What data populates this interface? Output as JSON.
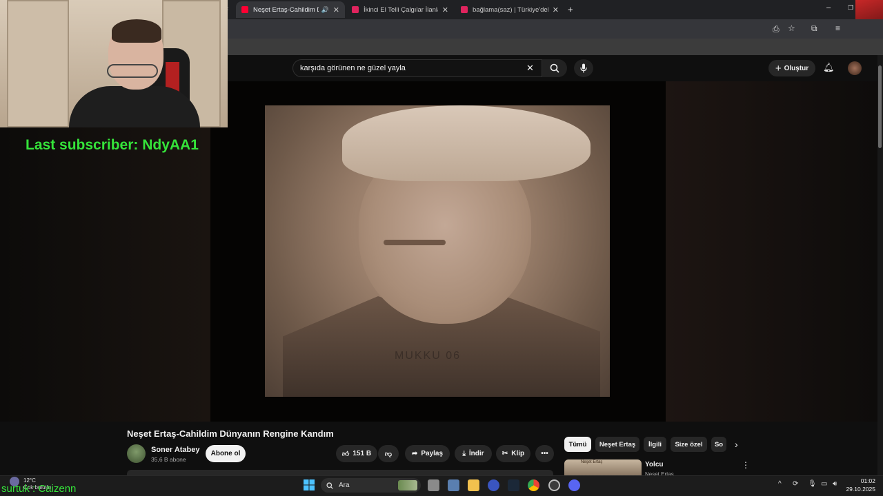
{
  "tabs": [
    {
      "title": "Neşet Ertaş-Cahildim Dünyanın",
      "favicon_color": "#ff0033",
      "active": true
    },
    {
      "title": "İkinci El Telli Çalgılar İlanları ve",
      "favicon_color": "#e0245e",
      "active": false
    },
    {
      "title": "bağlama(saz) | Türkiye'deki İkinci",
      "favicon_color": "#e0245e",
      "active": false
    }
  ],
  "new_tab_label": "+",
  "search": {
    "query": "karşıda görünen ne güzel yayla"
  },
  "header": {
    "create_label": "Oluştur"
  },
  "overlay": {
    "subscriber": "Last subscriber: NdyAA1",
    "streamer_tag": "surtuk : Caizenn"
  },
  "video": {
    "watermark": "MUKKU 06",
    "title": "Neşet Ertaş-Cahildim Dünyanın Rengine Kandım"
  },
  "channel": {
    "name": "Soner Atabey",
    "subscribers": "35,6 B abone",
    "subscribe_label": "Abone ol"
  },
  "actions": {
    "likes": "151 B",
    "share": "Paylaş",
    "download": "İndir",
    "clip": "Klip"
  },
  "chips": [
    "Tümü",
    "Neşet Ertaş",
    "İlgili",
    "Size özel",
    "So"
  ],
  "recommendation": {
    "title": "Yolcu",
    "channel": "Neşet Ertaş",
    "thumb_label": "Neşet Ertaş"
  },
  "taskbar": {
    "search_placeholder": "Ara",
    "weather_temp": "12°C",
    "weather_label": "Çok bulutlu",
    "time": "01:02",
    "date": "29.10.2025"
  },
  "colors": {
    "accent_green": "#35e33a",
    "youtube_red": "#ff0033",
    "background": "#0f0f0f"
  }
}
